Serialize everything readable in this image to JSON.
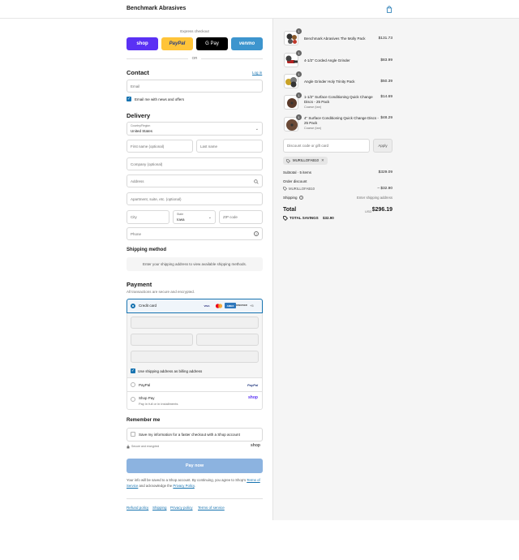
{
  "header": {
    "brand": "Benchmark Abrasives",
    "cart_icon": "shopping-bag-icon",
    "accent": "#1773b0"
  },
  "express": {
    "title": "Express checkout",
    "or": "OR",
    "buttons": [
      {
        "label": "shop",
        "color": "#5a31f4"
      },
      {
        "label": "PayPal",
        "color": "#ffc439"
      },
      {
        "label": "G Pay",
        "color": "#000000"
      },
      {
        "label": "venmo",
        "color": "#3d95ce"
      }
    ]
  },
  "contact": {
    "title": "Contact",
    "login": "Log in",
    "email_placeholder": "Email",
    "news_label": "Email me with news and offers"
  },
  "delivery": {
    "title": "Delivery",
    "country_label": "Country/Region",
    "country_value": "United States",
    "first_name": "First name (optional)",
    "last_name": "Last name",
    "company": "Company (optional)",
    "address": "Address",
    "apartment": "Apartment, suite, etc. (optional)",
    "city": "City",
    "state_label": "State",
    "state_value": "Iowa",
    "zip": "ZIP code",
    "phone": "Phone"
  },
  "shipping_method": {
    "title": "Shipping method",
    "notice": "Enter your shipping address to view available shipping methods."
  },
  "payment": {
    "title": "Payment",
    "subtitle": "All transactions are secure and encrypted.",
    "credit_card": "Credit card",
    "cards": [
      "VISA",
      "MC",
      "AMEX",
      "DISCOVER"
    ],
    "more": "+5",
    "billing_label": "Use shipping address as billing address",
    "paypal": "PayPal",
    "paypal_logo": "PayPal",
    "shop_pay": "Shop Pay",
    "shop_pay_sub": "Pay in full or in installments",
    "shop_logo": "shop"
  },
  "remember": {
    "title": "Remember me",
    "save_label": "Save my information for a faster checkout with a Shop account",
    "secure": "Secure and encrypted",
    "shop_logo": "shop"
  },
  "pay_button": "Pay now",
  "legal": {
    "prefix": "Your info will be saved to a Shop account. By continuing, you agree to Shop's",
    "terms": "Terms of Service",
    "middle": "and acknowledge the",
    "privacy": "Privacy Policy",
    "suffix": "."
  },
  "footer_links": [
    "Refund policy",
    "Shipping",
    "Privacy policy",
    "Terms of service"
  ],
  "cart": {
    "items": [
      {
        "qty": "1",
        "name": "Benchmark Abrasives The Molly Pack",
        "sub": "",
        "price": "$131.73",
        "icon": "tool-pack-icon"
      },
      {
        "qty": "1",
        "name": "4-1/2\" Corded Angle Grinder",
        "sub": "",
        "price": "$83.99",
        "icon": "angle-grinder-icon"
      },
      {
        "qty": "1",
        "name": "Angle Grinder Holy Trinity Pack",
        "sub": "",
        "price": "$50.39",
        "icon": "disc-pack-icon"
      },
      {
        "qty": "1",
        "name": "1-1/2\" Surface Conditioning Quick Change Discs - 25 Pack",
        "sub": "Coarse (tan)",
        "price": "$14.69",
        "icon": "disc-icon"
      },
      {
        "qty": "1",
        "name": "4\" Surface Conditioning Quick Change Discs - 25 Pack",
        "sub": "Coarse (tan)",
        "price": "$48.29",
        "icon": "disc-icon"
      }
    ],
    "discount_placeholder": "Discount code or gift card",
    "apply": "Apply",
    "code": "MURILLOFAB10",
    "subtotal_label": "Subtotal · 5 items",
    "subtotal": "$329.09",
    "order_discount_label": "Order discount",
    "discount_code": "MURILLOFAB10",
    "discount_amount": "– $32.90",
    "shipping_label": "Shipping",
    "shipping_value": "Enter shipping address",
    "total_label": "Total",
    "currency": "USD",
    "total": "$296.19",
    "savings_label": "TOTAL SAVINGS",
    "savings": "$32.90"
  }
}
